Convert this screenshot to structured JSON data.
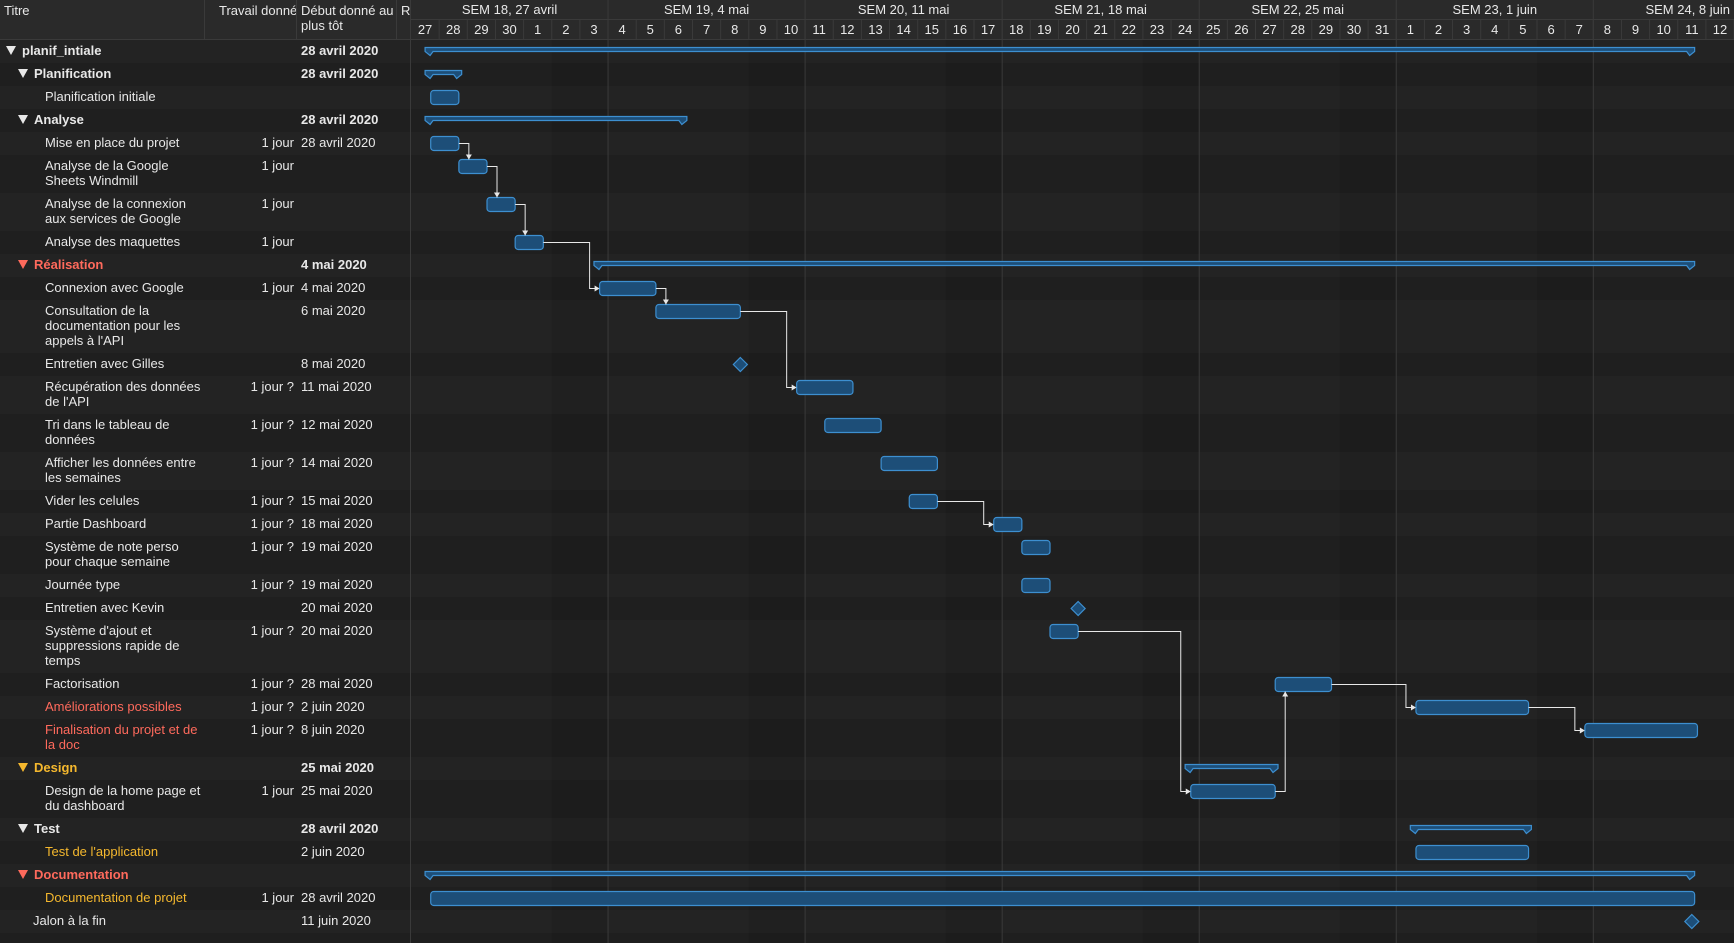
{
  "columns": {
    "title": "Titre",
    "work": "Travail donné",
    "start_line1": "Début donné au",
    "start_line2": "plus tôt",
    "extra": "R"
  },
  "weeks": [
    "SEM 18, 27 avril",
    "SEM 19, 4 mai",
    "SEM 20, 11 mai",
    "SEM 21, 18 mai",
    "SEM 22, 25 mai",
    "SEM 23, 1 juin",
    "SEM 24, 8 juin"
  ],
  "days": [
    "27",
    "28",
    "29",
    "30",
    "1",
    "2",
    "3",
    "4",
    "5",
    "6",
    "7",
    "8",
    "9",
    "10",
    "11",
    "12",
    "13",
    "14",
    "15",
    "16",
    "17",
    "18",
    "19",
    "20",
    "21",
    "22",
    "23",
    "24",
    "25",
    "26",
    "27",
    "28",
    "29",
    "30",
    "31",
    "1",
    "2",
    "3",
    "4",
    "5",
    "6",
    "7",
    "8",
    "9",
    "10",
    "11",
    "12"
  ],
  "colors": {
    "bar": "#1d4e78",
    "bar_border": "#3d8fd0",
    "red": "#ff6a5c",
    "orange": "#f5b82e",
    "white": "#e8e8e8"
  },
  "tasks": [
    {
      "id": 0,
      "title": [
        "planif_intiale"
      ],
      "work": "",
      "start": "28 avril 2020",
      "level": 0,
      "group": true,
      "color": "white",
      "bar": {
        "type": "summary",
        "s": 0.5,
        "e": 45.6
      }
    },
    {
      "id": 1,
      "title": [
        "Planification"
      ],
      "work": "",
      "start": "28 avril 2020",
      "level": 1,
      "group": true,
      "color": "white",
      "bar": {
        "type": "summary",
        "s": 0.5,
        "e": 1.8
      }
    },
    {
      "id": 2,
      "title": [
        "Planification initiale"
      ],
      "work": "",
      "start": "",
      "level": 2,
      "group": false,
      "color": "white",
      "bar": {
        "type": "task",
        "s": 0.7,
        "e": 1.7
      }
    },
    {
      "id": 3,
      "title": [
        "Analyse"
      ],
      "work": "",
      "start": "28 avril 2020",
      "level": 1,
      "group": true,
      "color": "white",
      "bar": {
        "type": "summary",
        "s": 0.5,
        "e": 9.8
      }
    },
    {
      "id": 4,
      "title": [
        "Mise en place du projet"
      ],
      "work": "1 jour",
      "start": "28 avril 2020",
      "level": 2,
      "group": false,
      "color": "white",
      "bar": {
        "type": "task",
        "s": 0.7,
        "e": 1.7
      }
    },
    {
      "id": 5,
      "title": [
        "Analyse de la Google",
        "Sheets Windmill"
      ],
      "work": "1 jour",
      "start": "",
      "level": 2,
      "group": false,
      "color": "white",
      "bar": {
        "type": "task",
        "s": 1.7,
        "e": 2.7
      }
    },
    {
      "id": 6,
      "title": [
        "Analyse de la connexion",
        "aux services de Google"
      ],
      "work": "1 jour",
      "start": "",
      "level": 2,
      "group": false,
      "color": "white",
      "bar": {
        "type": "task",
        "s": 2.7,
        "e": 3.7
      }
    },
    {
      "id": 7,
      "title": [
        "Analyse des maquettes"
      ],
      "work": "1 jour",
      "start": "",
      "level": 2,
      "group": false,
      "color": "white",
      "bar": {
        "type": "task",
        "s": 3.7,
        "e": 4.7
      }
    },
    {
      "id": 8,
      "title": [
        "Réalisation"
      ],
      "work": "",
      "start": "4 mai 2020",
      "level": 1,
      "group": true,
      "color": "red",
      "bar": {
        "type": "summary",
        "s": 6.5,
        "e": 45.6
      }
    },
    {
      "id": 9,
      "title": [
        "Connexion avec Google"
      ],
      "work": "1 jour",
      "start": "4 mai 2020",
      "level": 2,
      "group": false,
      "color": "white",
      "bar": {
        "type": "task",
        "s": 6.7,
        "e": 8.7
      }
    },
    {
      "id": 10,
      "title": [
        "Consultation de la",
        "documentation pour les",
        "appels à l'API"
      ],
      "work": "",
      "start": "6 mai 2020",
      "level": 2,
      "group": false,
      "color": "white",
      "bar": {
        "type": "task",
        "s": 8.7,
        "e": 11.7
      }
    },
    {
      "id": 11,
      "title": [
        "Entretien avec Gilles"
      ],
      "work": "",
      "start": "8 mai 2020",
      "level": 2,
      "group": false,
      "color": "white",
      "bar": {
        "type": "milestone",
        "s": 11.7
      }
    },
    {
      "id": 12,
      "title": [
        "Récupération des données",
        "de l'API"
      ],
      "work": "1 jour ?",
      "start": "11 mai 2020",
      "level": 2,
      "group": false,
      "color": "white",
      "bar": {
        "type": "task",
        "s": 13.7,
        "e": 15.7
      }
    },
    {
      "id": 13,
      "title": [
        "Tri dans le tableau de",
        "données"
      ],
      "work": "1 jour ?",
      "start": "12 mai 2020",
      "level": 2,
      "group": false,
      "color": "white",
      "bar": {
        "type": "task",
        "s": 14.7,
        "e": 16.7
      }
    },
    {
      "id": 14,
      "title": [
        "Afficher les données entre",
        "les semaines"
      ],
      "work": "1 jour ?",
      "start": "14 mai 2020",
      "level": 2,
      "group": false,
      "color": "white",
      "bar": {
        "type": "task",
        "s": 16.7,
        "e": 18.7
      }
    },
    {
      "id": 15,
      "title": [
        "Vider les celules"
      ],
      "work": "1 jour ?",
      "start": "15 mai 2020",
      "level": 2,
      "group": false,
      "color": "white",
      "bar": {
        "type": "task",
        "s": 17.7,
        "e": 18.7
      }
    },
    {
      "id": 16,
      "title": [
        "Partie Dashboard"
      ],
      "work": "1 jour ?",
      "start": "18 mai 2020",
      "level": 2,
      "group": false,
      "color": "white",
      "bar": {
        "type": "task",
        "s": 20.7,
        "e": 21.7
      }
    },
    {
      "id": 17,
      "title": [
        "Système de note perso",
        "pour chaque semaine"
      ],
      "work": "1 jour ?",
      "start": "19 mai 2020",
      "level": 2,
      "group": false,
      "color": "white",
      "bar": {
        "type": "task",
        "s": 21.7,
        "e": 22.7
      }
    },
    {
      "id": 18,
      "title": [
        "Journée type"
      ],
      "work": "1 jour ?",
      "start": "19 mai 2020",
      "level": 2,
      "group": false,
      "color": "white",
      "bar": {
        "type": "task",
        "s": 21.7,
        "e": 22.7
      }
    },
    {
      "id": 19,
      "title": [
        "Entretien avec Kevin"
      ],
      "work": "",
      "start": "20 mai 2020",
      "level": 2,
      "group": false,
      "color": "white",
      "bar": {
        "type": "milestone",
        "s": 23.7
      }
    },
    {
      "id": 20,
      "title": [
        "Système d'ajout et",
        "suppressions rapide de",
        "temps"
      ],
      "work": "1 jour ?",
      "start": "20 mai 2020",
      "level": 2,
      "group": false,
      "color": "white",
      "bar": {
        "type": "task",
        "s": 22.7,
        "e": 23.7
      }
    },
    {
      "id": 21,
      "title": [
        "Factorisation"
      ],
      "work": "1 jour ?",
      "start": "28 mai 2020",
      "level": 2,
      "group": false,
      "color": "white",
      "bar": {
        "type": "task",
        "s": 30.7,
        "e": 32.7
      }
    },
    {
      "id": 22,
      "title": [
        "Améliorations possibles"
      ],
      "work": "1 jour ?",
      "start": "2 juin 2020",
      "level": 2,
      "group": false,
      "color": "red",
      "bar": {
        "type": "task",
        "s": 35.7,
        "e": 39.7
      }
    },
    {
      "id": 23,
      "title": [
        "Finalisation du projet et de",
        "la doc"
      ],
      "work": "1 jour ?",
      "start": "8 juin 2020",
      "level": 2,
      "group": false,
      "color": "red",
      "bar": {
        "type": "task",
        "s": 41.7,
        "e": 45.7
      }
    },
    {
      "id": 24,
      "title": [
        "Design"
      ],
      "work": "",
      "start": "25 mai 2020",
      "level": 1,
      "group": true,
      "color": "orange",
      "bar": {
        "type": "summary",
        "s": 27.5,
        "e": 30.8
      }
    },
    {
      "id": 25,
      "title": [
        "Design de la home page et",
        "du dashboard"
      ],
      "work": "1 jour",
      "start": "25 mai 2020",
      "level": 2,
      "group": false,
      "color": "white",
      "bar": {
        "type": "task",
        "s": 27.7,
        "e": 30.7
      }
    },
    {
      "id": 26,
      "title": [
        "Test"
      ],
      "work": "",
      "start": "28 avril 2020",
      "level": 1,
      "group": true,
      "color": "white",
      "bar": {
        "type": "summary",
        "s": 35.5,
        "e": 39.8
      }
    },
    {
      "id": 27,
      "title": [
        "Test de l'application"
      ],
      "work": "",
      "start": "2 juin 2020",
      "level": 2,
      "group": false,
      "color": "orange",
      "bar": {
        "type": "task",
        "s": 35.7,
        "e": 39.7
      }
    },
    {
      "id": 28,
      "title": [
        "Documentation"
      ],
      "work": "",
      "start": "",
      "level": 1,
      "group": true,
      "color": "red",
      "bar": {
        "type": "summary",
        "s": 0.5,
        "e": 45.6
      }
    },
    {
      "id": 29,
      "title": [
        "Documentation de projet"
      ],
      "work": "1 jour",
      "start": "28 avril 2020",
      "level": 2,
      "group": false,
      "color": "orange",
      "bar": {
        "type": "task",
        "s": 0.7,
        "e": 45.6
      }
    },
    {
      "id": 30,
      "title": [
        "Jalon à la fin"
      ],
      "work": "",
      "start": "11 juin 2020",
      "level": 1,
      "group": false,
      "color": "white",
      "bar": {
        "type": "milestone",
        "s": 45.5
      }
    }
  ],
  "links": [
    [
      4,
      5
    ],
    [
      5,
      6
    ],
    [
      6,
      7
    ],
    [
      7,
      9
    ],
    [
      9,
      10
    ],
    [
      10,
      12
    ],
    [
      15,
      16
    ],
    [
      20,
      25
    ],
    [
      25,
      21
    ],
    [
      21,
      22
    ],
    [
      22,
      23
    ]
  ]
}
